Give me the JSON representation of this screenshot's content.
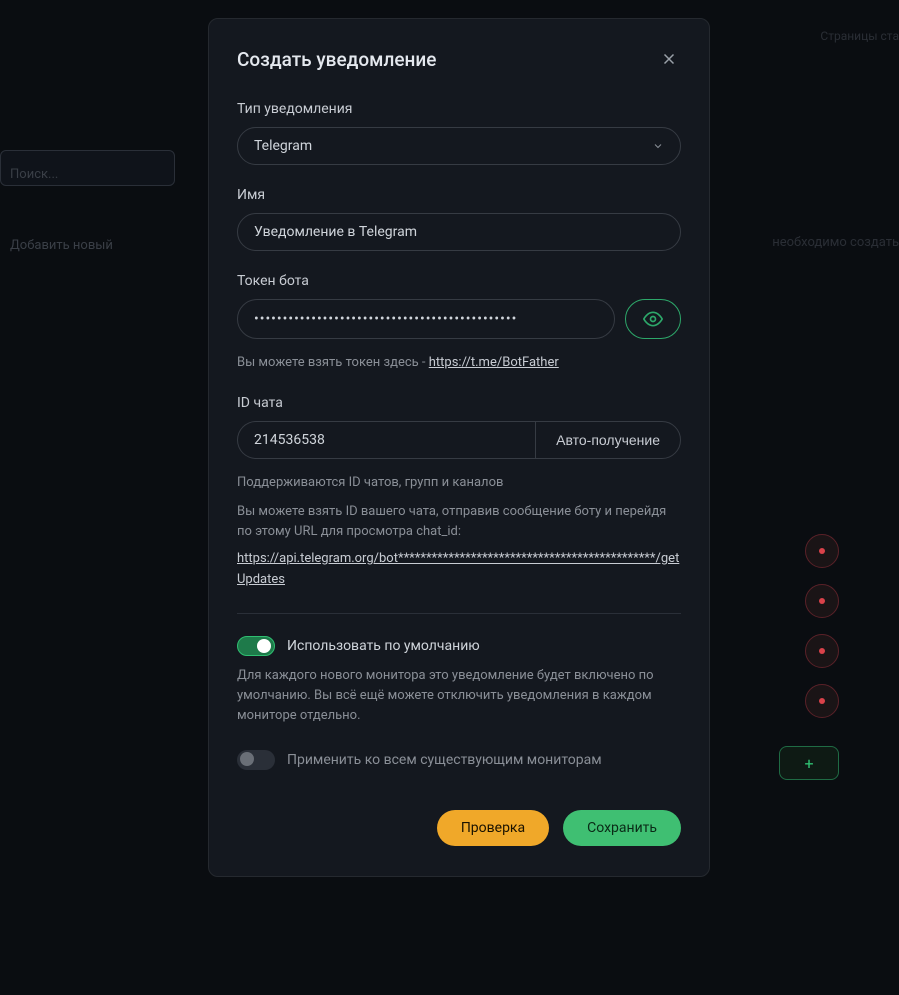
{
  "background": {
    "search_placeholder": "Поиск...",
    "label_new": "Добавить новый",
    "top_right": "Страницы ста",
    "right_text": "необходимо создать"
  },
  "modal": {
    "title": "Создать уведомление",
    "type_label": "Тип уведомления",
    "type_value": "Telegram",
    "name_label": "Имя",
    "name_value": "Уведомление в Telegram",
    "token_label": "Токен бота",
    "token_value": "••••••••••••••••••••••••••••••••••••••••••••••",
    "token_hint_prefix": "Вы можете взять токен здесь - ",
    "token_hint_link": "https://t.me/BotFather",
    "chatid_label": "ID чата",
    "chatid_value": "214536538",
    "autoget_label": "Авто-получение",
    "chatid_hint1": "Поддерживаются ID чатов, групп и каналов",
    "chatid_hint2": "Вы можете взять ID вашего чата, отправив сообщение боту и перейдя по этому URL для просмотра chat_id:",
    "chatid_url": "https://api.telegram.org/bot**********************************************/getUpdates",
    "default_toggle_label": "Использовать по умолчанию",
    "default_toggle_desc": "Для каждого нового монитора это уведомление будет включено по умолчанию. Вы всё ещё можете отключить уведомления в каждом мониторе отдельно.",
    "apply_all_label": "Применить ко всем существующим мониторам",
    "test_button": "Проверка",
    "save_button": "Сохранить"
  }
}
